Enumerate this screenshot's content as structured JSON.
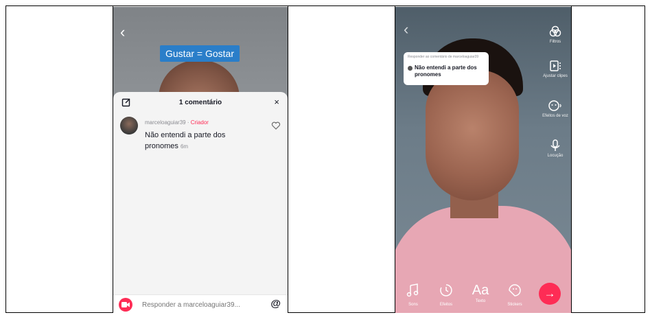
{
  "left_screen": {
    "sticker_text": "Gustar = Gostar",
    "comments_sheet": {
      "title": "1 comentário",
      "comment": {
        "username": "marceloaguiar39",
        "separator": " · ",
        "badge": "Criador",
        "text": "Não entendi a parte dos pronomes",
        "time": "6m"
      },
      "reply_placeholder": "Responder a marceloaguiar39...",
      "mention_symbol": "@",
      "close_symbol": "×"
    },
    "icons": [
      "back-arrow-icon",
      "edit-icon",
      "close-icon",
      "heart-icon",
      "camera-icon",
      "mention-icon"
    ]
  },
  "right_screen": {
    "reply_bubble": {
      "header": "Responder ao comentário de marceloaguiar39",
      "text": "Não entendi a parte dos pronomes"
    },
    "side_tools": [
      {
        "label": "Filtros",
        "icon": "filters-icon"
      },
      {
        "label": "Ajustar clipes",
        "icon": "adjust-clips-icon"
      },
      {
        "label": "Efeitos de voz",
        "icon": "voice-effects-icon"
      },
      {
        "label": "Locução",
        "icon": "voiceover-icon"
      }
    ],
    "bottom_tools": [
      {
        "label": "Sons",
        "icon": "music-note-icon"
      },
      {
        "label": "Efeitos",
        "icon": "effects-timer-icon"
      },
      {
        "label": "Texto",
        "glyph": "Aa",
        "icon": "text-icon"
      },
      {
        "label": "Stickers",
        "icon": "sticker-icon"
      }
    ],
    "next_symbol": "→"
  },
  "colors": {
    "accent": "#fe2c55",
    "sticker_blue": "#2a7ec9",
    "shirt_pink": "#e7a7b4"
  }
}
